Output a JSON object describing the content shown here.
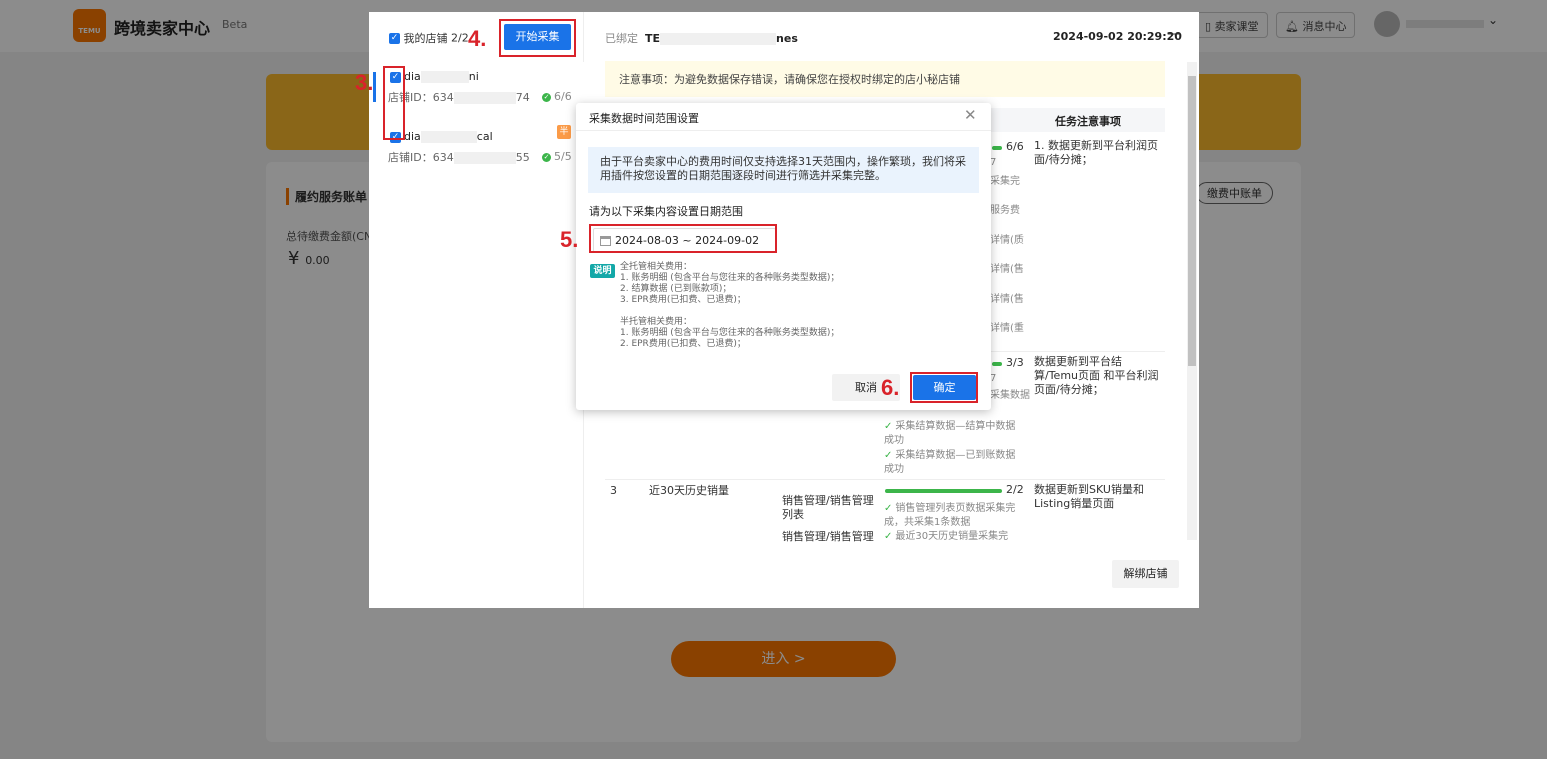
{
  "app": {
    "logo_text": "TEMU",
    "brand": "跨境卖家中心",
    "beta": "Beta",
    "top_buttons": [
      "卖家课堂",
      "消息中心"
    ]
  },
  "background_card": {
    "title": "履约服务账单",
    "amount_label": "总待缴费金额(CNY",
    "currency": "¥",
    "amount": "0.00",
    "bill_button": "缴费中账单",
    "enter_button": "进入 >"
  },
  "panel": {
    "my_stores_label": "我的店铺",
    "my_stores_count": "2/2",
    "start_button": "开始采集",
    "stores": [
      {
        "name_prefix": "dia",
        "name_suffix": "ni",
        "id_prefix": "店铺ID：634",
        "id_suffix": "74",
        "progress": "6/6"
      },
      {
        "name_prefix": "dia",
        "name_suffix": "cal",
        "id_prefix": "店铺ID：634",
        "id_suffix": "55",
        "progress": "5/5",
        "badge": "半"
      }
    ],
    "bound_label": "已绑定",
    "bound_prefix": "TE",
    "bound_suffix": "nes",
    "datetime": "2024-09-02 20:29:20",
    "minimize": "—",
    "notice": "注意事项：为避免数据保存错误，请确保您在授权时绑定的店小秘店铺",
    "table_header_notes": "任务注意事项",
    "rows": [
      {
        "progress": "6/6",
        "sub_frag": [
          "7",
          "采集完",
          "服务费",
          "详情(质",
          "详情(售",
          "详情(售",
          "详情(重"
        ],
        "note": "1. 数据更新到平台利润页面/待分摊；"
      },
      {
        "progress": "3/3",
        "sub_frag": [
          "7",
          "采集数据",
          "采集结算数据—结算中数据成功",
          "采集结算数据—已到账数据成功"
        ],
        "note": "数据更新到平台结算/Temu页面 和平台利润页面/待分摊；"
      },
      {
        "index": "3",
        "name": "近30天历史销量",
        "module_1": "销售管理/销售管理列表",
        "progress": "2/2",
        "detail_1": "销售管理列表页数据采集完成，共采集1条数据",
        "module_2": "销售管理/销售管理",
        "detail_2": "最近30天历史销量采集完",
        "note": "数据更新到SKU销量和Listing销量页面"
      }
    ],
    "unbind_button": "解绑店铺"
  },
  "dialog": {
    "title": "采集数据时间范围设置",
    "close": "✕",
    "info": "由于平台卖家中心的费用时间仅支持选择31天范围内，操作繁琐，我们将采用插件按您设置的日期范围逐段时间进行筛选并采集完整。",
    "date_label": "请为以下采集内容设置日期范围",
    "date_range": "2024-08-03 ~ 2024-09-02",
    "note_badge": "说明",
    "notes": [
      "全托管相关费用：",
      "1. 账务明细 (包含平台与您往来的各种账务类型数据)；",
      "2. 结算数据 (已到账款项)；",
      "3. EPR费用(已扣费、已退费)；",
      "",
      "半托管相关费用：",
      "1. 账务明细 (包含平台与您往来的各种账务类型数据)；",
      "2. EPR费用(已扣费、已退费)；"
    ],
    "cancel_button": "取消",
    "ok_button": "确定"
  },
  "annotations": [
    "3.",
    "4.",
    "5.",
    "6."
  ],
  "colors": {
    "accent": "#1a73e8",
    "brand": "#fb7701",
    "annotation": "#d9232a",
    "success": "#3cb54a"
  }
}
